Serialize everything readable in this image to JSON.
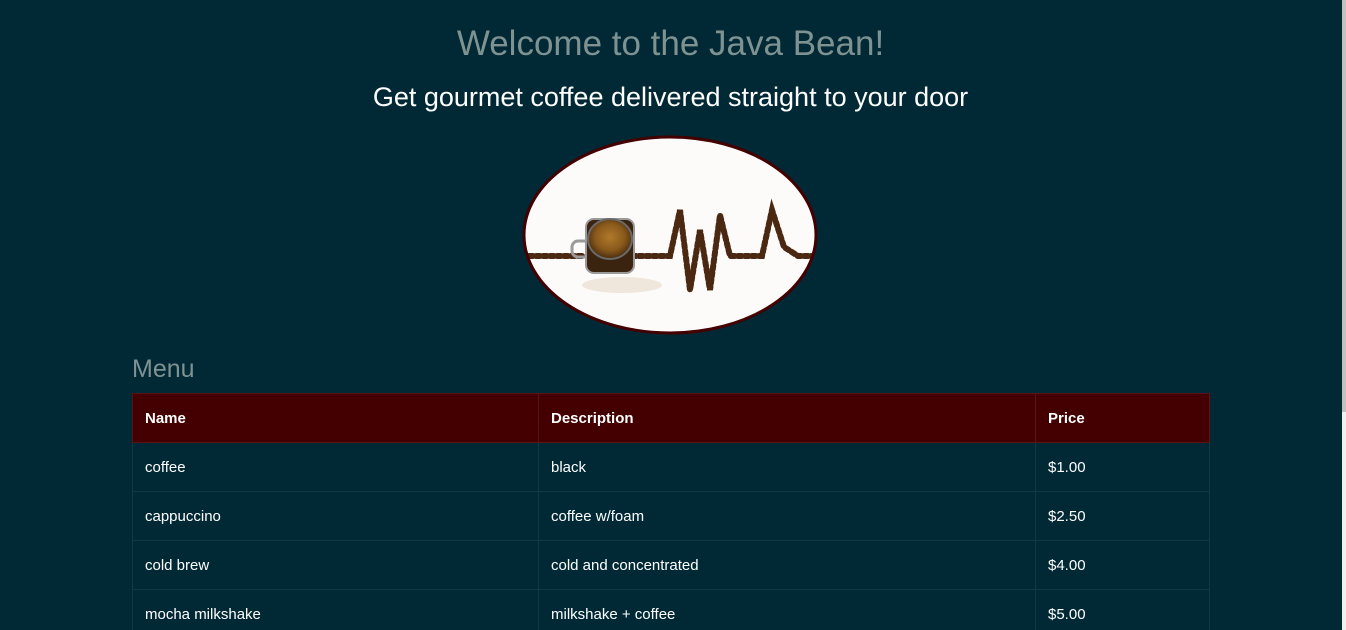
{
  "header": {
    "title": "Welcome to the Java Bean!",
    "subtitle": "Get gourmet coffee delivered straight to your door"
  },
  "hero_image": {
    "icon": "coffee-heartbeat-image",
    "bg_color": "#fdfbfa",
    "border_color": "#440000"
  },
  "menu": {
    "heading": "Menu",
    "columns": [
      "Name",
      "Description",
      "Price"
    ],
    "rows": [
      {
        "name": "coffee",
        "description": "black",
        "price": "$1.00"
      },
      {
        "name": "cappuccino",
        "description": "coffee w/foam",
        "price": "$2.50"
      },
      {
        "name": "cold brew",
        "description": "cold and concentrated",
        "price": "$4.00"
      },
      {
        "name": "mocha milkshake",
        "description": "milkshake + coffee",
        "price": "$5.00"
      }
    ]
  },
  "colors": {
    "background": "#002935",
    "header_row": "#440000",
    "title_text": "#7f9292",
    "body_text": "#ffffff"
  }
}
